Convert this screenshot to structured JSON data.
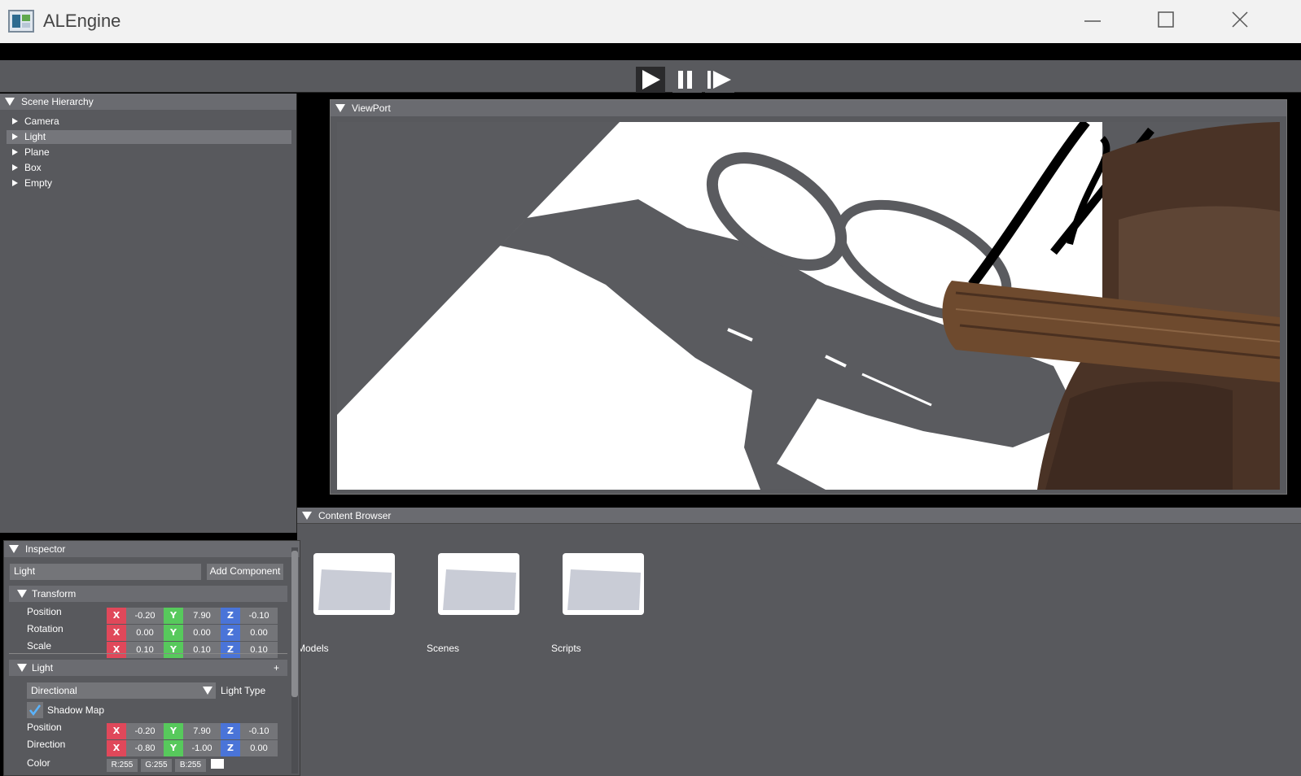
{
  "window": {
    "title": "ALEngine"
  },
  "toolbar": {
    "play_icon": "play-icon",
    "pause_icon": "pause-icon",
    "step_icon": "step-forward-icon"
  },
  "hierarchy": {
    "title": "Scene Hierarchy",
    "items": [
      {
        "label": "Camera",
        "selected": false
      },
      {
        "label": "Light",
        "selected": true
      },
      {
        "label": "Plane",
        "selected": false
      },
      {
        "label": "Box",
        "selected": false
      },
      {
        "label": "Empty",
        "selected": false
      }
    ]
  },
  "viewport": {
    "title": "ViewPort"
  },
  "content_browser": {
    "title": "Content Browser",
    "folders": [
      {
        "label": "Models",
        "icon": "folder-icon"
      },
      {
        "label": "Scenes",
        "icon": "folder-icon"
      },
      {
        "label": "Scripts",
        "icon": "folder-icon"
      }
    ]
  },
  "inspector": {
    "title": "Inspector",
    "name_value": "Light",
    "add_component_label": "Add Component",
    "transform": {
      "title": "Transform",
      "position_label": "Position",
      "rotation_label": "Rotation",
      "scale_label": "Scale",
      "position": {
        "x": "-0.20",
        "y": "7.90",
        "z": "-0.10"
      },
      "rotation": {
        "x": "0.00",
        "y": "0.00",
        "z": "0.00"
      },
      "scale": {
        "x": "0.10",
        "y": "0.10",
        "z": "0.10"
      }
    },
    "light": {
      "title": "Light",
      "add_symbol": "+",
      "type_value": "Directional",
      "type_label": "Light Type",
      "shadow_map_label": "Shadow Map",
      "shadow_map_checked": true,
      "position_label": "Position",
      "direction_label": "Direction",
      "color_label": "Color",
      "position": {
        "x": "-0.20",
        "y": "7.90",
        "z": "-0.10"
      },
      "direction": {
        "x": "-0.80",
        "y": "-1.00",
        "z": "0.00"
      },
      "color": {
        "r": "R:255",
        "g": "G:255",
        "b": "B:255"
      },
      "color_swatch": "#ffffff"
    },
    "axis_labels": {
      "x": "X",
      "y": "Y",
      "z": "Z"
    }
  },
  "colors": {
    "panel_bg": "#58595d",
    "header_bg": "#6a6b70",
    "axis_x": "#e0485a",
    "axis_y": "#57c95c",
    "axis_z": "#4a74d8"
  }
}
